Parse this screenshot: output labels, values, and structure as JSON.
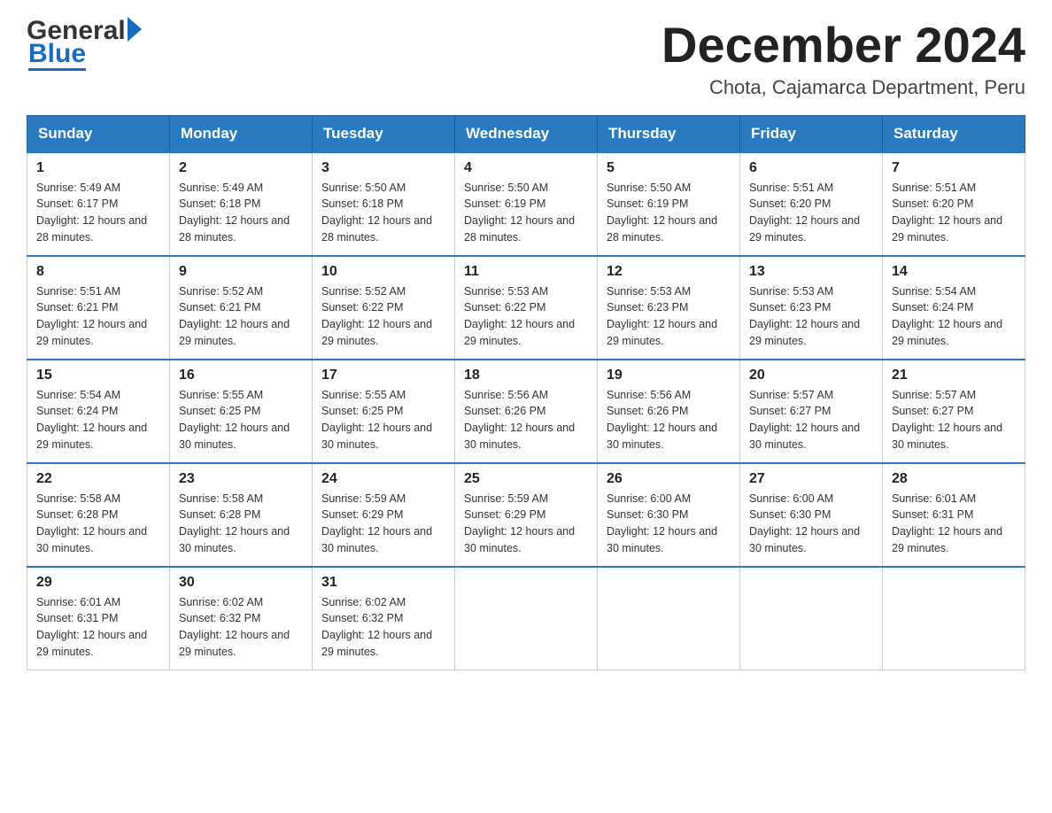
{
  "header": {
    "logo_general": "General",
    "logo_blue": "Blue",
    "month_title": "December 2024",
    "location": "Chota, Cajamarca Department, Peru"
  },
  "calendar": {
    "days_of_week": [
      "Sunday",
      "Monday",
      "Tuesday",
      "Wednesday",
      "Thursday",
      "Friday",
      "Saturday"
    ],
    "weeks": [
      [
        {
          "day": "1",
          "sunrise": "Sunrise: 5:49 AM",
          "sunset": "Sunset: 6:17 PM",
          "daylight": "Daylight: 12 hours and 28 minutes."
        },
        {
          "day": "2",
          "sunrise": "Sunrise: 5:49 AM",
          "sunset": "Sunset: 6:18 PM",
          "daylight": "Daylight: 12 hours and 28 minutes."
        },
        {
          "day": "3",
          "sunrise": "Sunrise: 5:50 AM",
          "sunset": "Sunset: 6:18 PM",
          "daylight": "Daylight: 12 hours and 28 minutes."
        },
        {
          "day": "4",
          "sunrise": "Sunrise: 5:50 AM",
          "sunset": "Sunset: 6:19 PM",
          "daylight": "Daylight: 12 hours and 28 minutes."
        },
        {
          "day": "5",
          "sunrise": "Sunrise: 5:50 AM",
          "sunset": "Sunset: 6:19 PM",
          "daylight": "Daylight: 12 hours and 28 minutes."
        },
        {
          "day": "6",
          "sunrise": "Sunrise: 5:51 AM",
          "sunset": "Sunset: 6:20 PM",
          "daylight": "Daylight: 12 hours and 29 minutes."
        },
        {
          "day": "7",
          "sunrise": "Sunrise: 5:51 AM",
          "sunset": "Sunset: 6:20 PM",
          "daylight": "Daylight: 12 hours and 29 minutes."
        }
      ],
      [
        {
          "day": "8",
          "sunrise": "Sunrise: 5:51 AM",
          "sunset": "Sunset: 6:21 PM",
          "daylight": "Daylight: 12 hours and 29 minutes."
        },
        {
          "day": "9",
          "sunrise": "Sunrise: 5:52 AM",
          "sunset": "Sunset: 6:21 PM",
          "daylight": "Daylight: 12 hours and 29 minutes."
        },
        {
          "day": "10",
          "sunrise": "Sunrise: 5:52 AM",
          "sunset": "Sunset: 6:22 PM",
          "daylight": "Daylight: 12 hours and 29 minutes."
        },
        {
          "day": "11",
          "sunrise": "Sunrise: 5:53 AM",
          "sunset": "Sunset: 6:22 PM",
          "daylight": "Daylight: 12 hours and 29 minutes."
        },
        {
          "day": "12",
          "sunrise": "Sunrise: 5:53 AM",
          "sunset": "Sunset: 6:23 PM",
          "daylight": "Daylight: 12 hours and 29 minutes."
        },
        {
          "day": "13",
          "sunrise": "Sunrise: 5:53 AM",
          "sunset": "Sunset: 6:23 PM",
          "daylight": "Daylight: 12 hours and 29 minutes."
        },
        {
          "day": "14",
          "sunrise": "Sunrise: 5:54 AM",
          "sunset": "Sunset: 6:24 PM",
          "daylight": "Daylight: 12 hours and 29 minutes."
        }
      ],
      [
        {
          "day": "15",
          "sunrise": "Sunrise: 5:54 AM",
          "sunset": "Sunset: 6:24 PM",
          "daylight": "Daylight: 12 hours and 29 minutes."
        },
        {
          "day": "16",
          "sunrise": "Sunrise: 5:55 AM",
          "sunset": "Sunset: 6:25 PM",
          "daylight": "Daylight: 12 hours and 30 minutes."
        },
        {
          "day": "17",
          "sunrise": "Sunrise: 5:55 AM",
          "sunset": "Sunset: 6:25 PM",
          "daylight": "Daylight: 12 hours and 30 minutes."
        },
        {
          "day": "18",
          "sunrise": "Sunrise: 5:56 AM",
          "sunset": "Sunset: 6:26 PM",
          "daylight": "Daylight: 12 hours and 30 minutes."
        },
        {
          "day": "19",
          "sunrise": "Sunrise: 5:56 AM",
          "sunset": "Sunset: 6:26 PM",
          "daylight": "Daylight: 12 hours and 30 minutes."
        },
        {
          "day": "20",
          "sunrise": "Sunrise: 5:57 AM",
          "sunset": "Sunset: 6:27 PM",
          "daylight": "Daylight: 12 hours and 30 minutes."
        },
        {
          "day": "21",
          "sunrise": "Sunrise: 5:57 AM",
          "sunset": "Sunset: 6:27 PM",
          "daylight": "Daylight: 12 hours and 30 minutes."
        }
      ],
      [
        {
          "day": "22",
          "sunrise": "Sunrise: 5:58 AM",
          "sunset": "Sunset: 6:28 PM",
          "daylight": "Daylight: 12 hours and 30 minutes."
        },
        {
          "day": "23",
          "sunrise": "Sunrise: 5:58 AM",
          "sunset": "Sunset: 6:28 PM",
          "daylight": "Daylight: 12 hours and 30 minutes."
        },
        {
          "day": "24",
          "sunrise": "Sunrise: 5:59 AM",
          "sunset": "Sunset: 6:29 PM",
          "daylight": "Daylight: 12 hours and 30 minutes."
        },
        {
          "day": "25",
          "sunrise": "Sunrise: 5:59 AM",
          "sunset": "Sunset: 6:29 PM",
          "daylight": "Daylight: 12 hours and 30 minutes."
        },
        {
          "day": "26",
          "sunrise": "Sunrise: 6:00 AM",
          "sunset": "Sunset: 6:30 PM",
          "daylight": "Daylight: 12 hours and 30 minutes."
        },
        {
          "day": "27",
          "sunrise": "Sunrise: 6:00 AM",
          "sunset": "Sunset: 6:30 PM",
          "daylight": "Daylight: 12 hours and 30 minutes."
        },
        {
          "day": "28",
          "sunrise": "Sunrise: 6:01 AM",
          "sunset": "Sunset: 6:31 PM",
          "daylight": "Daylight: 12 hours and 29 minutes."
        }
      ],
      [
        {
          "day": "29",
          "sunrise": "Sunrise: 6:01 AM",
          "sunset": "Sunset: 6:31 PM",
          "daylight": "Daylight: 12 hours and 29 minutes."
        },
        {
          "day": "30",
          "sunrise": "Sunrise: 6:02 AM",
          "sunset": "Sunset: 6:32 PM",
          "daylight": "Daylight: 12 hours and 29 minutes."
        },
        {
          "day": "31",
          "sunrise": "Sunrise: 6:02 AM",
          "sunset": "Sunset: 6:32 PM",
          "daylight": "Daylight: 12 hours and 29 minutes."
        },
        null,
        null,
        null,
        null
      ]
    ]
  }
}
